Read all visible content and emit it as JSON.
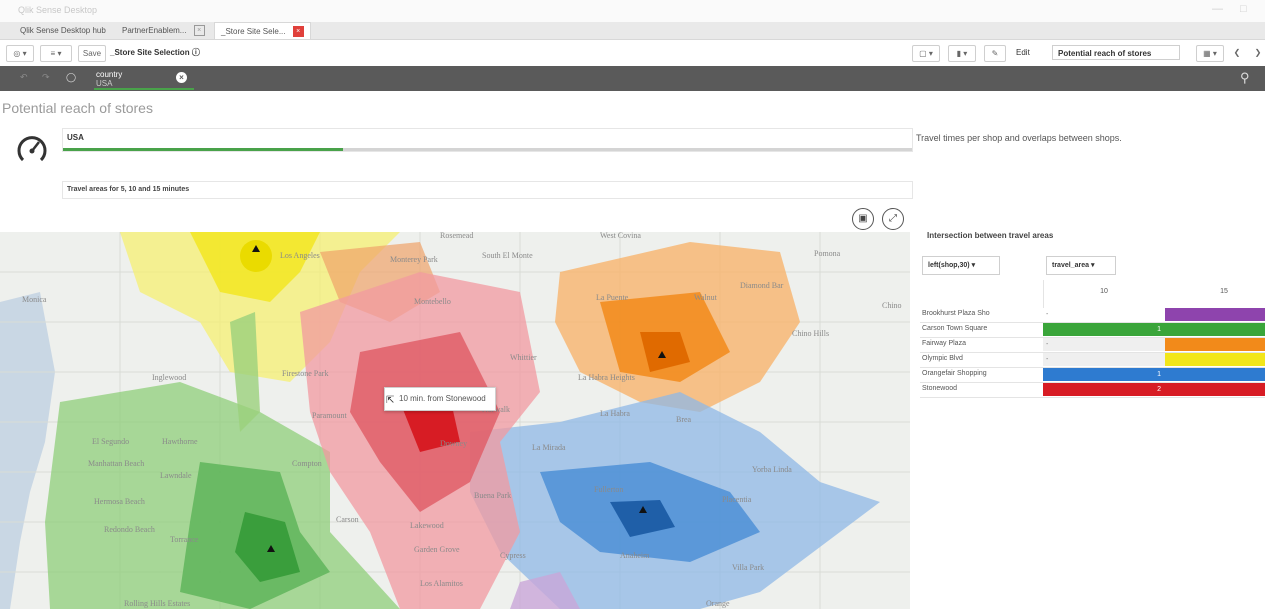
{
  "window": {
    "title": "Qlik Sense Desktop"
  },
  "tabs": [
    {
      "label": "Qlik Sense Desktop hub"
    },
    {
      "label": "PartnerEnablem..."
    },
    {
      "label": "_Store Site Sele..."
    }
  ],
  "toolbar": {
    "save_label": "Save",
    "sheet_title": "_Store Site Selection",
    "edit_label": "Edit",
    "current_sheet": "Potential reach of stores"
  },
  "selections": {
    "field": "country",
    "value": "USA"
  },
  "page": {
    "title": "Potential reach of stores",
    "kpi_label": "USA",
    "kpi_progress": 0.33,
    "travel_label": "Travel areas for 5, 10 and 15 minutes",
    "description": "Travel times per shop and overlaps between shops."
  },
  "map": {
    "tooltip": "10 min. from Stonewood",
    "place_labels": [
      "Rosemead",
      "West Covina",
      "Pomona",
      "Monterey Park",
      "South El Monte",
      "Los Angeles",
      "Montebello",
      "Monica",
      "La Puente",
      "Walnut",
      "Diamond Bar",
      "Chino",
      "Chino Hills",
      "Whittier",
      "Inglewood",
      "Firestone Park",
      "La Habra Heights",
      "La Habra",
      "El Segundo",
      "Hawthorne",
      "Manhattan Beach",
      "Lawndale",
      "Compton",
      "La Mirada",
      "Hermosa Beach",
      "Redondo Beach",
      "Torrance",
      "Carson",
      "Buena Park",
      "Yorba Linda",
      "Fullerton",
      "Placentia",
      "Anaheim",
      "Cypress",
      "Los Alamitos",
      "Villa Park",
      "Rolling Hills Estates",
      "Garden Grove",
      "Orange",
      "Lakewood",
      "Paramount",
      "Downey",
      "Norwalk",
      "Brea"
    ],
    "store_colors": [
      "#f2e61a",
      "#f28a1a",
      "#d71c24",
      "#2e7bd0",
      "#3aa53a",
      "#9b59b6"
    ]
  },
  "pivot": {
    "title": "Intersection between travel areas",
    "row_dim": "left(shop,30)",
    "col_dim": "travel_area",
    "columns": [
      "10",
      "15"
    ],
    "rows": [
      {
        "label": "Brookhurst Plaza Sho",
        "c1": "-",
        "c1_color": "#ffffff",
        "c2_color": "#8e44ad"
      },
      {
        "label": "Carson Town Square",
        "c1": "1",
        "c1_color": "#3aa53a",
        "c2_color": "#3aa53a"
      },
      {
        "label": "Fairway Plaza",
        "c1": "-",
        "c1_color": "#efefef",
        "c2_color": "#f28a1a"
      },
      {
        "label": "Olympic Blvd",
        "c1": "-",
        "c1_color": "#efefef",
        "c2_color": "#f2e61a"
      },
      {
        "label": "Orangefair Shopping",
        "c1": "1",
        "c1_color": "#2e7bd0",
        "c2_color": "#2e7bd0"
      },
      {
        "label": "Stonewood",
        "c1": "2",
        "c1_color": "#d71c24",
        "c2_color": "#d71c24"
      }
    ]
  }
}
